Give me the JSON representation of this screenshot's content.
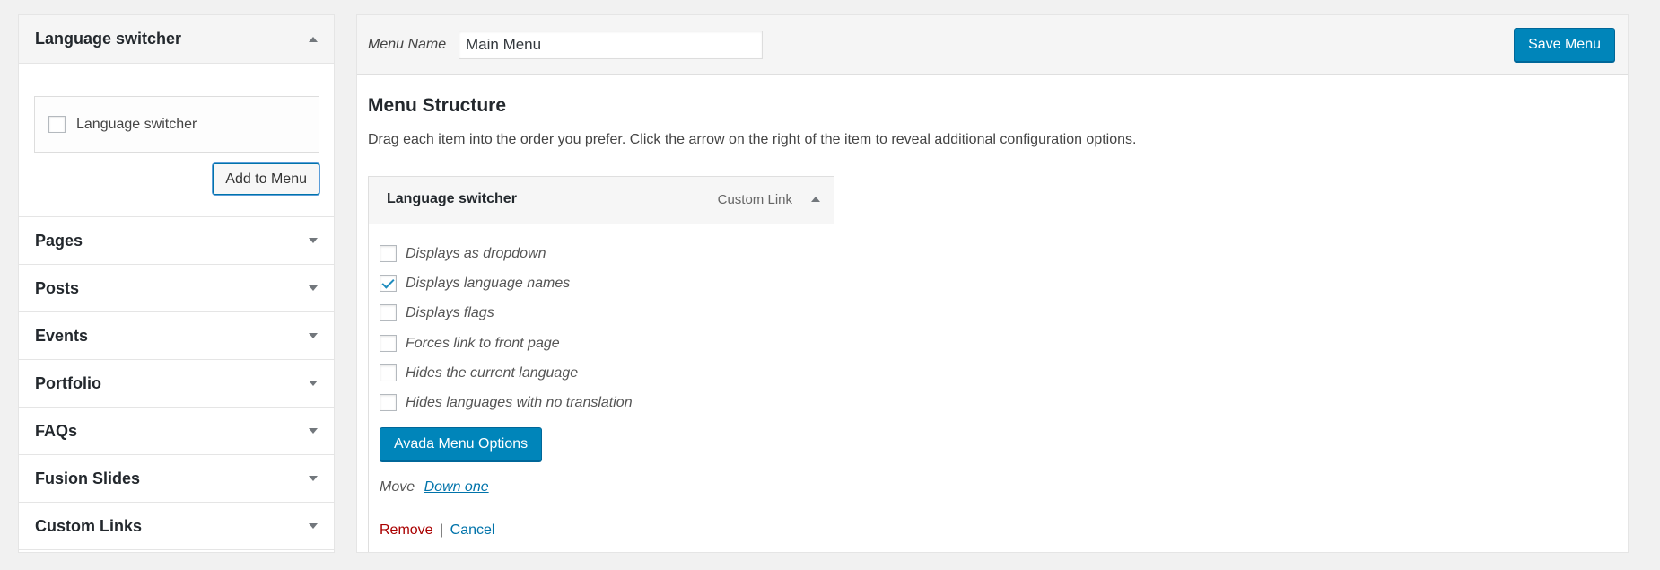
{
  "left_panel": {
    "open_section": {
      "title": "Language switcher",
      "checkbox_label": "Language switcher",
      "add_button_label": "Add to Menu"
    },
    "sections": [
      {
        "title": "Pages"
      },
      {
        "title": "Posts"
      },
      {
        "title": "Events"
      },
      {
        "title": "Portfolio"
      },
      {
        "title": "FAQs"
      },
      {
        "title": "Fusion Slides"
      },
      {
        "title": "Custom Links"
      }
    ]
  },
  "menu_header": {
    "name_label": "Menu Name",
    "name_value": "Main Menu",
    "save_label": "Save Menu"
  },
  "menu_structure": {
    "title": "Menu Structure",
    "instructions": "Drag each item into the order you prefer. Click the arrow on the right of the item to reveal additional configuration options.",
    "item": {
      "title": "Language switcher",
      "type": "Custom Link",
      "options": [
        {
          "label": "Displays as dropdown",
          "checked": false
        },
        {
          "label": "Displays language names",
          "checked": true
        },
        {
          "label": "Displays flags",
          "checked": false
        },
        {
          "label": "Forces link to front page",
          "checked": false
        },
        {
          "label": "Hides the current language",
          "checked": false
        },
        {
          "label": "Hides languages with no translation",
          "checked": false
        }
      ],
      "avada_button_label": "Avada Menu Options",
      "move_label": "Move",
      "move_link": "Down one",
      "remove_label": "Remove",
      "separator": "|",
      "cancel_label": "Cancel"
    }
  },
  "colors": {
    "primary": "#0085ba",
    "link": "#0073aa",
    "danger": "#a00000",
    "background": "#f1f1f1"
  }
}
